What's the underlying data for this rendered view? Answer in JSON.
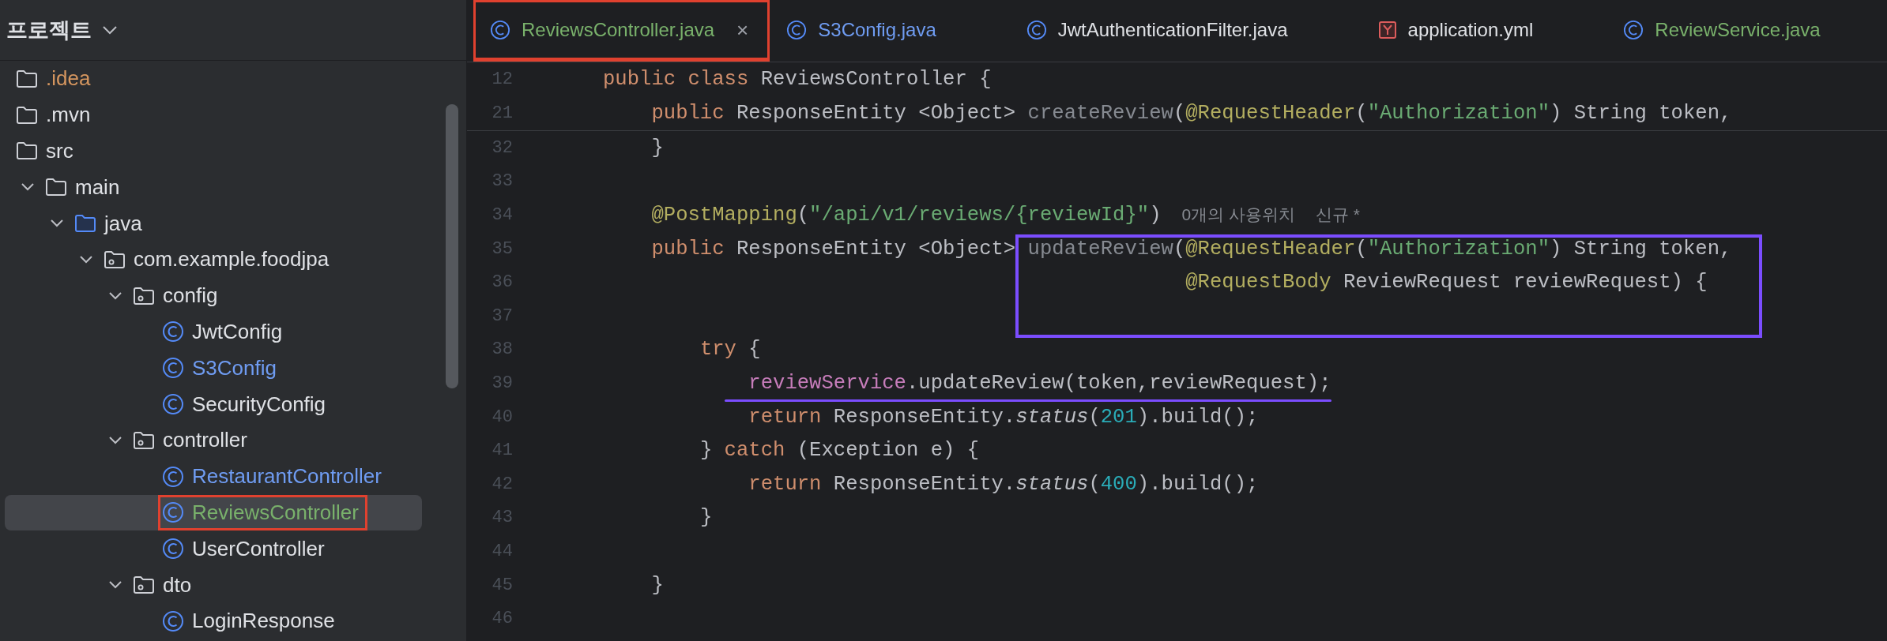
{
  "sidebar": {
    "title": "프로젝트",
    "tree": [
      {
        "name": ".idea",
        "kind": "folder",
        "color": "#d5965f",
        "selected": false,
        "highlighted": false
      },
      {
        "name": ".mvn",
        "kind": "folder",
        "color": "#dfe1e5",
        "selected": false,
        "highlighted": false
      },
      {
        "name": "src",
        "kind": "folder",
        "color": "#dfe1e5",
        "selected": false,
        "highlighted": false,
        "children": [
          {
            "name": "main",
            "kind": "folder",
            "color": "#dfe1e5",
            "selected": false,
            "highlighted": false,
            "expanded": true,
            "children": [
              {
                "name": "java",
                "kind": "source-root",
                "color": "#dfe1e5",
                "selected": false,
                "highlighted": false,
                "expanded": true,
                "children": [
                  {
                    "name": "com.example.foodjpa",
                    "kind": "package",
                    "color": "#dfe1e5",
                    "selected": false,
                    "highlighted": false,
                    "expanded": true,
                    "children": [
                      {
                        "name": "config",
                        "kind": "package",
                        "color": "#dfe1e5",
                        "selected": false,
                        "highlighted": false,
                        "expanded": true,
                        "children": [
                          {
                            "name": "JwtConfig",
                            "kind": "class",
                            "color": "#dfe1e5",
                            "selected": false,
                            "highlighted": false
                          },
                          {
                            "name": "S3Config",
                            "kind": "class",
                            "color": "#6f9cf2",
                            "selected": false,
                            "highlighted": false
                          },
                          {
                            "name": "SecurityConfig",
                            "kind": "class",
                            "color": "#dfe1e5",
                            "selected": false,
                            "highlighted": false
                          }
                        ]
                      },
                      {
                        "name": "controller",
                        "kind": "package",
                        "color": "#dfe1e5",
                        "selected": false,
                        "highlighted": false,
                        "expanded": true,
                        "children": [
                          {
                            "name": "RestaurantController",
                            "kind": "class",
                            "color": "#6f9cf2",
                            "selected": false,
                            "highlighted": false
                          },
                          {
                            "name": "ReviewsController",
                            "kind": "class",
                            "color": "#79b16b",
                            "selected": true,
                            "highlighted": true
                          },
                          {
                            "name": "UserController",
                            "kind": "class",
                            "color": "#dfe1e5",
                            "selected": false,
                            "highlighted": false
                          }
                        ]
                      },
                      {
                        "name": "dto",
                        "kind": "package",
                        "color": "#dfe1e5",
                        "selected": false,
                        "highlighted": false,
                        "expanded": true,
                        "children": [
                          {
                            "name": "LoginResponse",
                            "kind": "class",
                            "color": "#dfe1e5",
                            "selected": false,
                            "highlighted": false
                          }
                        ]
                      }
                    ]
                  }
                ]
              }
            ]
          }
        ]
      }
    ]
  },
  "tabs": [
    {
      "label": "ReviewsController.java",
      "kind": "java",
      "color": "#79b16b",
      "selected": true,
      "highlighted": true,
      "close": "×"
    },
    {
      "label": "S3Config.java",
      "kind": "java",
      "color": "#6f9cf2",
      "selected": false,
      "highlighted": false
    },
    {
      "label": "JwtAuthenticationFilter.java",
      "kind": "java",
      "color": "#dfe1e5",
      "selected": false,
      "highlighted": false
    },
    {
      "label": "application.yml",
      "kind": "yaml",
      "color": "#dfe1e5",
      "selected": false,
      "highlighted": false
    },
    {
      "label": "ReviewService.java",
      "kind": "java",
      "color": "#79b16b",
      "selected": false,
      "highlighted": false
    }
  ],
  "editor": {
    "lines": [
      {
        "number": "12",
        "kind": "sticky",
        "tokens": [
          {
            "kind": "keyword",
            "text": "public class"
          },
          {
            "kind": "plain",
            "text": " ReviewsController {"
          }
        ]
      },
      {
        "number": "21",
        "kind": "sticky",
        "tokens": [
          {
            "kind": "keyword",
            "text": "    public"
          },
          {
            "kind": "plain",
            "text": " ResponseEntity <Object> "
          },
          {
            "kind": "unused",
            "text": "createReview"
          },
          {
            "kind": "plain",
            "text": "("
          },
          {
            "kind": "annotation",
            "text": "@RequestHeader"
          },
          {
            "kind": "plain",
            "text": "("
          },
          {
            "kind": "string",
            "text": "\"Authorization\""
          },
          {
            "kind": "plain",
            "text": ") String token,"
          }
        ]
      },
      {
        "number": "32",
        "kind": "code",
        "tokens": [
          {
            "kind": "plain",
            "text": "    }"
          }
        ]
      },
      {
        "number": "33",
        "kind": "code"
      },
      {
        "number": "34",
        "kind": "code",
        "tokens": [
          {
            "kind": "annotation",
            "text": "    @PostMapping"
          },
          {
            "kind": "plain",
            "text": "("
          },
          {
            "kind": "string",
            "text": "\"/api/v1/reviews/{reviewId}\""
          },
          {
            "kind": "plain",
            "text": ")"
          },
          {
            "kind": "hint",
            "text": "0개의 사용위치"
          },
          {
            "kind": "hint",
            "text": "신규 *"
          }
        ]
      },
      {
        "number": "35",
        "kind": "code",
        "box": true,
        "tokens": [
          {
            "kind": "keyword",
            "text": "    public"
          },
          {
            "kind": "plain",
            "text": " ResponseEntity <Object> "
          },
          {
            "kind": "unused",
            "text": "updateReview",
            "box_start": true
          },
          {
            "kind": "plain",
            "text": "("
          },
          {
            "kind": "annotation",
            "text": "@RequestHeader"
          },
          {
            "kind": "plain",
            "text": "("
          },
          {
            "kind": "string",
            "text": "\"Authorization\""
          },
          {
            "kind": "plain",
            "text": ") String token,"
          }
        ]
      },
      {
        "number": "36",
        "kind": "code",
        "box": true,
        "tokens": [
          {
            "kind": "annotation",
            "text": "                                                @RequestBody"
          },
          {
            "kind": "plain",
            "text": " ReviewRequest reviewRequest) {"
          }
        ]
      },
      {
        "number": "37",
        "kind": "code",
        "box": true
      },
      {
        "number": "38",
        "kind": "code",
        "tokens": [
          {
            "kind": "keyword",
            "text": "        try"
          },
          {
            "kind": "plain",
            "text": " {"
          }
        ]
      },
      {
        "number": "39",
        "kind": "code",
        "underline": true,
        "tokens": [
          {
            "kind": "field",
            "text": "            reviewService"
          },
          {
            "kind": "plain",
            "text": ".updateReview(token,reviewRequest);"
          }
        ]
      },
      {
        "number": "40",
        "kind": "code",
        "tokens": [
          {
            "kind": "keyword",
            "text": "            return"
          },
          {
            "kind": "plain",
            "text": " ResponseEntity."
          },
          {
            "kind": "static",
            "text": "status"
          },
          {
            "kind": "plain",
            "text": "("
          },
          {
            "kind": "number",
            "text": "201"
          },
          {
            "kind": "plain",
            "text": ").build();"
          }
        ]
      },
      {
        "number": "41",
        "kind": "code",
        "tokens": [
          {
            "kind": "plain",
            "text": "        } "
          },
          {
            "kind": "keyword",
            "text": "catch"
          },
          {
            "kind": "plain",
            "text": " (Exception e) {"
          }
        ]
      },
      {
        "number": "42",
        "kind": "code",
        "tokens": [
          {
            "kind": "keyword",
            "text": "            return"
          },
          {
            "kind": "plain",
            "text": " ResponseEntity."
          },
          {
            "kind": "static",
            "text": "status"
          },
          {
            "kind": "plain",
            "text": "("
          },
          {
            "kind": "number",
            "text": "400"
          },
          {
            "kind": "plain",
            "text": ").build();"
          }
        ]
      },
      {
        "number": "43",
        "kind": "code",
        "tokens": [
          {
            "kind": "plain",
            "text": "        }"
          }
        ]
      },
      {
        "number": "44",
        "kind": "code"
      },
      {
        "number": "45",
        "kind": "code",
        "tokens": [
          {
            "kind": "plain",
            "text": "    }"
          }
        ]
      },
      {
        "number": "46",
        "kind": "code"
      }
    ]
  }
}
